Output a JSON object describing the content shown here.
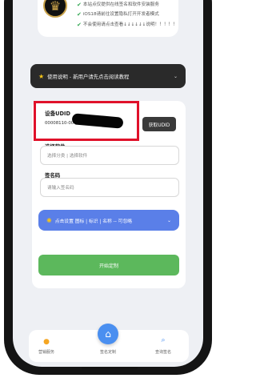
{
  "notices": [
    "本站点仅提供在线签名和软件安装服务",
    "iOS18请前往设置隐私打开开发者模式",
    "不会使用请点击查看↓↓↓↓↓↓说明！！！！！"
  ],
  "banner": {
    "label": "使用说明 - 新用户请先点击阅读教程"
  },
  "udid": {
    "label": "设备UDID",
    "value": "00008110-00",
    "button": "获取UDID"
  },
  "software": {
    "label": "选择软件",
    "placeholder": "选择分类 | 选择软件"
  },
  "signcode": {
    "label": "签名码",
    "placeholder": "请输入签名码"
  },
  "settings_button": {
    "label": "点击设置 图标 | 标识 | 名称 -- 可忽略"
  },
  "start_button": {
    "label": "开始定制"
  },
  "tabbar": {
    "help": "营销服务",
    "sign": "签名定制",
    "query": "查询签名"
  },
  "colors": {
    "accent": "#5a7fe8",
    "primary": "#5cb85c",
    "highlight": "#e0112a"
  }
}
